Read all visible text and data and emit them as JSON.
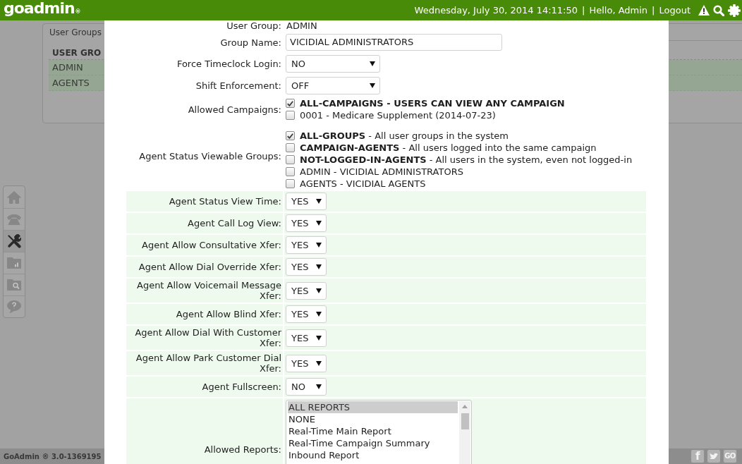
{
  "top_bar": {
    "logo": "goadmin",
    "logo_mark": "®",
    "date_time": "Wednesday, July 30, 2014 14:11:50",
    "separators": [
      "|",
      "|"
    ],
    "greeting": "Hello, Admin",
    "logout": "Logout"
  },
  "sidebar": {
    "items": [
      {
        "selected": false
      },
      {
        "selected": false
      },
      {
        "selected": true
      },
      {
        "selected": false
      },
      {
        "selected": false
      },
      {
        "selected": false
      }
    ]
  },
  "background_panel": {
    "title": "User Groups",
    "column_header": "USER GRO",
    "rows": [
      "ADMIN",
      "AGENTS"
    ]
  },
  "footer": {
    "version": "GoAdmin ® 3.0-1369195",
    "social": [
      {
        "kind": "letter",
        "text": "f"
      },
      {
        "kind": "bird"
      },
      {
        "kind": "letter",
        "text": "GO"
      }
    ]
  },
  "dialog": {
    "sections": [
      {
        "shaded": false,
        "fields": [
          {
            "kind": "static",
            "label": "User Group:",
            "value": "ADMIN"
          },
          {
            "kind": "text_input",
            "label": "Group Name:",
            "value": "VICIDIAL ADMINISTRATORS"
          },
          {
            "kind": "select",
            "label": "Force Timeclock Login:",
            "value": "NO"
          },
          {
            "kind": "select",
            "label": "Shift Enforcement:",
            "value": "OFF"
          },
          {
            "kind": "checklist",
            "label": "Allowed Campaigns:",
            "options": [
              {
                "text": "ALL-CAMPAIGNS - USERS CAN VIEW ANY CAMPAIGN",
                "bold": true,
                "checked": true
              },
              {
                "text": "0001 - Medicare Supplement (2014-07-23)",
                "bold": false,
                "checked": false
              }
            ]
          },
          {
            "kind": "checklist",
            "label": "Agent Status Viewable Groups:",
            "options": [
              {
                "text": "**ALL-GROUPS** - All user groups in the system",
                "bold": false,
                "checked": true
              },
              {
                "text": "**CAMPAIGN-AGENTS** - All users logged into the same campaign",
                "bold": false,
                "checked": false
              },
              {
                "text": "**NOT-LOGGED-IN-AGENTS** - All users in the system, even not logged-in",
                "bold": false,
                "checked": false
              },
              {
                "text": "ADMIN - VICIDIAL ADMINISTRATORS",
                "bold": false,
                "checked": false
              },
              {
                "text": "AGENTS - VICIDIAL AGENTS",
                "bold": false,
                "checked": false
              }
            ]
          }
        ]
      },
      {
        "shaded": true,
        "fields": [
          {
            "kind": "select",
            "label": "Agent Status View Time:",
            "value": "YES"
          },
          {
            "kind": "select",
            "label": "Agent Call Log View:",
            "value": "YES"
          },
          {
            "kind": "select",
            "label": "Agent Allow Consultative Xfer:",
            "value": "YES"
          },
          {
            "kind": "select",
            "label": "Agent Allow Dial Override Xfer:",
            "value": "YES"
          },
          {
            "kind": "select",
            "label": "Agent Allow Voicemail Message Xfer:",
            "value": "YES"
          },
          {
            "kind": "select",
            "label": "Agent Allow Blind Xfer:",
            "value": "YES"
          },
          {
            "kind": "select",
            "label": "Agent Allow Dial With Customer Xfer:",
            "value": "YES"
          },
          {
            "kind": "select",
            "label": "Agent Allow Park Customer Dial Xfer:",
            "value": "YES"
          },
          {
            "kind": "select",
            "label": "Agent Fullscreen:",
            "value": "NO"
          },
          {
            "kind": "listbox",
            "label": "Allowed Reports:",
            "options": [
              {
                "text": "ALL REPORTS",
                "selected": true
              },
              {
                "text": "NONE",
                "selected": false
              },
              {
                "text": "Real-Time Main Report",
                "selected": false
              },
              {
                "text": "Real-Time Campaign Summary",
                "selected": false
              },
              {
                "text": "Inbound Report",
                "selected": false
              }
            ]
          }
        ]
      }
    ]
  }
}
